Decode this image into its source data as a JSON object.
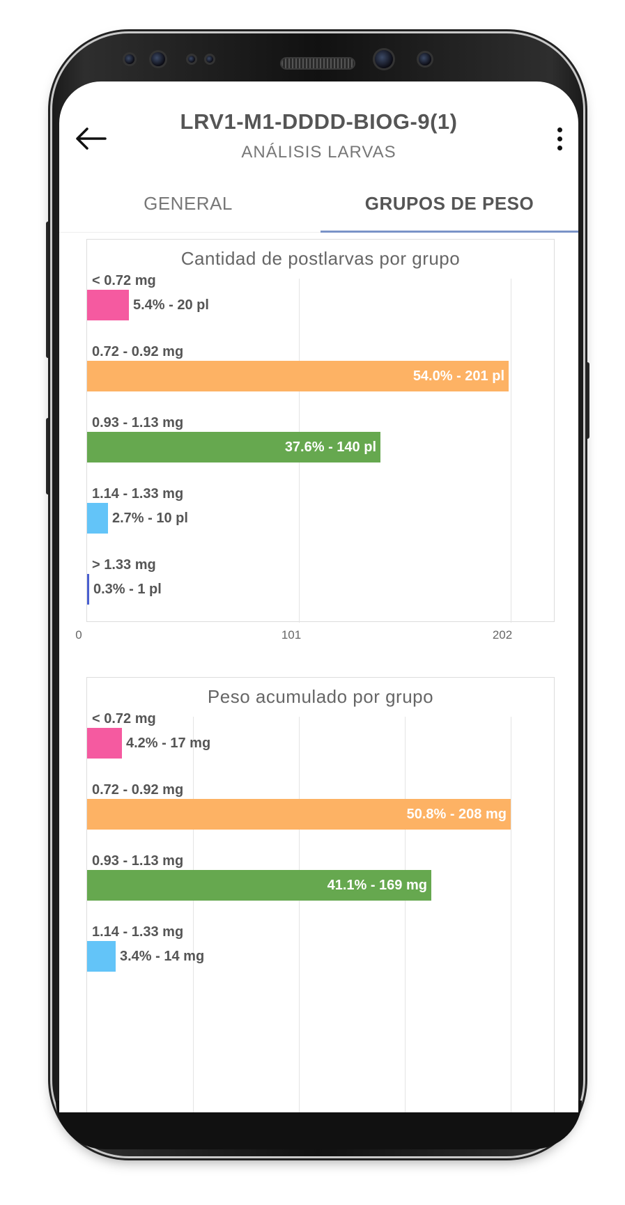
{
  "app": {
    "title": "LRV1-M1-DDDD-BIOG-9(1)",
    "subtitle": "ANÁLISIS LARVAS",
    "back_icon": "arrow-left-icon",
    "menu_icon": "more-vertical-icon"
  },
  "tabs": [
    {
      "label": "GENERAL",
      "active": false
    },
    {
      "label": "GRUPOS DE PESO",
      "active": true
    }
  ],
  "colors": {
    "pink": "#f55aa0",
    "orange": "#fdb264",
    "green": "#66a84f",
    "blue": "#63c4f8",
    "indigo": "#4a5fd0",
    "tab_indicator": "#7a93c7"
  },
  "charts": {
    "count": {
      "title": "Cantidad de postlarvas por grupo",
      "axis_ticks": [
        "0",
        "101",
        "202"
      ]
    },
    "weight": {
      "title": "Peso acumulado por grupo"
    }
  },
  "chart_data": [
    {
      "type": "bar",
      "orientation": "horizontal",
      "title": "Cantidad de postlarvas por grupo",
      "categories": [
        "< 0.72 mg",
        "0.72 - 0.92 mg",
        "0.93 - 1.13 mg",
        "1.14 - 1.33 mg",
        "> 1.33 mg"
      ],
      "values": [
        20,
        201,
        140,
        10,
        1
      ],
      "labels": [
        "5.4% - 20 pl",
        "54.0% - 201 pl",
        "37.6% - 140 pl",
        "2.7% - 10 pl",
        "0.3% - 1 pl"
      ],
      "colors": [
        "#f55aa0",
        "#fdb264",
        "#66a84f",
        "#63c4f8",
        "#4a5fd0"
      ],
      "xlim": [
        0,
        202
      ],
      "xticks": [
        0,
        101,
        202
      ],
      "grid": true
    },
    {
      "type": "bar",
      "orientation": "horizontal",
      "title": "Peso acumulado por grupo",
      "categories": [
        "< 0.72 mg",
        "0.72 - 0.92 mg",
        "0.93 - 1.13 mg",
        "1.14 - 1.33 mg"
      ],
      "values": [
        17,
        208,
        169,
        14
      ],
      "labels": [
        "4.2% - 17 mg",
        "50.8% - 208 mg",
        "41.1% - 169 mg",
        "3.4% - 14 mg"
      ],
      "colors": [
        "#f55aa0",
        "#fdb264",
        "#66a84f",
        "#63c4f8"
      ],
      "xlim": [
        0,
        208
      ],
      "grid": true
    }
  ]
}
